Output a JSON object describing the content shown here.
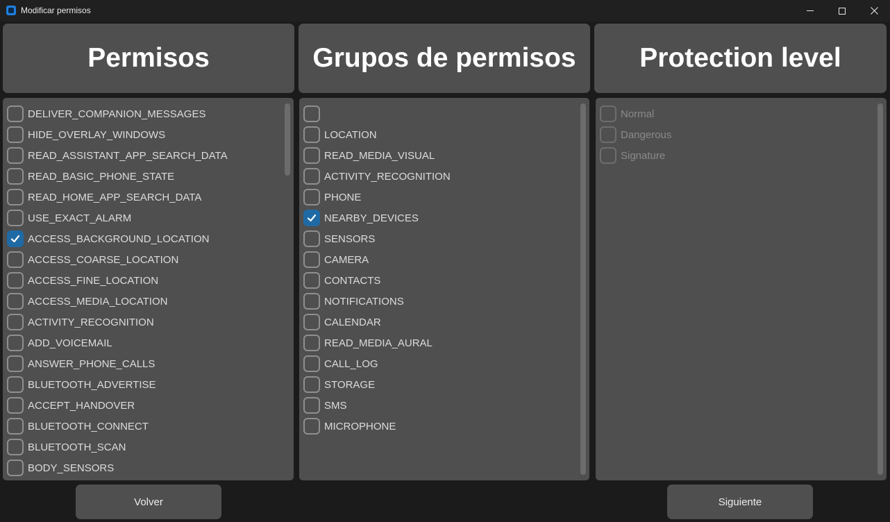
{
  "window": {
    "title": "Modificar permisos"
  },
  "headers": {
    "permisos": "Permisos",
    "grupos": "Grupos de permisos",
    "protection": "Protection level"
  },
  "permisos_list": [
    {
      "label": "DELIVER_COMPANION_MESSAGES",
      "checked": false
    },
    {
      "label": "HIDE_OVERLAY_WINDOWS",
      "checked": false
    },
    {
      "label": "READ_ASSISTANT_APP_SEARCH_DATA",
      "checked": false
    },
    {
      "label": "READ_BASIC_PHONE_STATE",
      "checked": false
    },
    {
      "label": "READ_HOME_APP_SEARCH_DATA",
      "checked": false
    },
    {
      "label": "USE_EXACT_ALARM",
      "checked": false
    },
    {
      "label": "ACCESS_BACKGROUND_LOCATION",
      "checked": true
    },
    {
      "label": "ACCESS_COARSE_LOCATION",
      "checked": false
    },
    {
      "label": "ACCESS_FINE_LOCATION",
      "checked": false
    },
    {
      "label": "ACCESS_MEDIA_LOCATION",
      "checked": false
    },
    {
      "label": "ACTIVITY_RECOGNITION",
      "checked": false
    },
    {
      "label": "ADD_VOICEMAIL",
      "checked": false
    },
    {
      "label": "ANSWER_PHONE_CALLS",
      "checked": false
    },
    {
      "label": "BLUETOOTH_ADVERTISE",
      "checked": false
    },
    {
      "label": "ACCEPT_HANDOVER",
      "checked": false
    },
    {
      "label": "BLUETOOTH_CONNECT",
      "checked": false
    },
    {
      "label": "BLUETOOTH_SCAN",
      "checked": false
    },
    {
      "label": "BODY_SENSORS",
      "checked": false
    }
  ],
  "grupos_list": [
    {
      "label": "",
      "checked": false
    },
    {
      "label": "LOCATION",
      "checked": false
    },
    {
      "label": "READ_MEDIA_VISUAL",
      "checked": false
    },
    {
      "label": "ACTIVITY_RECOGNITION",
      "checked": false
    },
    {
      "label": "PHONE",
      "checked": false
    },
    {
      "label": "NEARBY_DEVICES",
      "checked": true
    },
    {
      "label": "SENSORS",
      "checked": false
    },
    {
      "label": "CAMERA",
      "checked": false
    },
    {
      "label": "CONTACTS",
      "checked": false
    },
    {
      "label": "NOTIFICATIONS",
      "checked": false
    },
    {
      "label": "CALENDAR",
      "checked": false
    },
    {
      "label": "READ_MEDIA_AURAL",
      "checked": false
    },
    {
      "label": "CALL_LOG",
      "checked": false
    },
    {
      "label": "STORAGE",
      "checked": false
    },
    {
      "label": "SMS",
      "checked": false
    },
    {
      "label": "MICROPHONE",
      "checked": false
    }
  ],
  "protection_list": [
    {
      "label": "Normal",
      "checked": false,
      "disabled": true
    },
    {
      "label": "Dangerous",
      "checked": false,
      "disabled": true
    },
    {
      "label": "Signature",
      "checked": false,
      "disabled": true
    }
  ],
  "buttons": {
    "back": "Volver",
    "next": "Siguiente"
  },
  "colors": {
    "accent": "#1f6aa5",
    "panel": "#4f4f4f",
    "background": "#1b1b1b"
  }
}
